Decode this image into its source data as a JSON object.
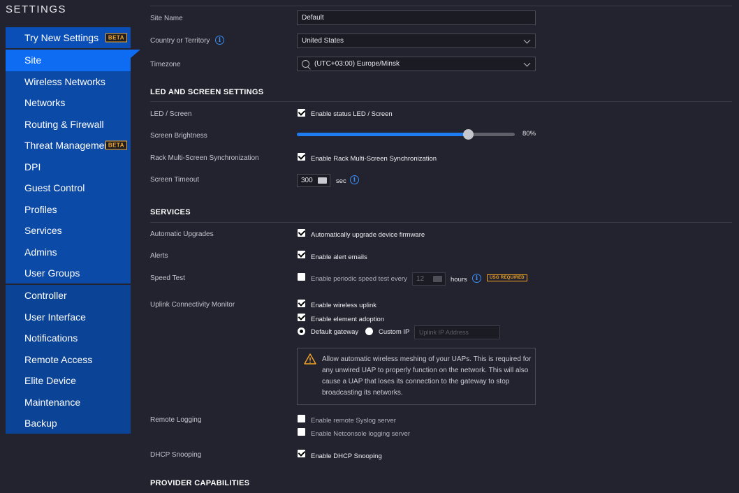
{
  "sidebar": {
    "title": "SETTINGS",
    "top_item": {
      "label": "Try New Settings",
      "badge": "BETA"
    },
    "items": [
      {
        "label": "Site"
      },
      {
        "label": "Wireless Networks"
      },
      {
        "label": "Networks"
      },
      {
        "label": "Routing & Firewall"
      },
      {
        "label": "Threat Management",
        "badge": "BETA"
      },
      {
        "label": "DPI"
      },
      {
        "label": "Guest Control"
      },
      {
        "label": "Profiles"
      },
      {
        "label": "Services"
      },
      {
        "label": "Admins"
      },
      {
        "label": "User Groups"
      }
    ],
    "items2": [
      {
        "label": "Controller"
      },
      {
        "label": "User Interface"
      },
      {
        "label": "Notifications"
      },
      {
        "label": "Remote Access"
      },
      {
        "label": "Elite Device"
      },
      {
        "label": "Maintenance"
      },
      {
        "label": "Backup"
      }
    ]
  },
  "site": {
    "site_name_label": "Site Name",
    "site_name_value": "Default",
    "country_label": "Country or Territory",
    "country_value": "United States",
    "timezone_label": "Timezone",
    "timezone_value": "(UTC+03:00) Europe/Minsk"
  },
  "led": {
    "section_title": "LED AND SCREEN SETTINGS",
    "led_label": "LED / Screen",
    "led_option": "Enable status LED / Screen",
    "brightness_label": "Screen Brightness",
    "brightness_value": "80%",
    "brightness_fraction": 0.785,
    "rack_label": "Rack Multi-Screen Synchronization",
    "rack_option": "Enable Rack Multi-Screen Synchronization",
    "timeout_label": "Screen Timeout",
    "timeout_value": "300",
    "timeout_unit": "sec"
  },
  "services": {
    "section_title": "SERVICES",
    "auto_upgrades_label": "Automatic Upgrades",
    "auto_upgrades_option": "Automatically upgrade device firmware",
    "alerts_label": "Alerts",
    "alerts_option": "Enable alert emails",
    "speed_label": "Speed Test",
    "speed_option": "Enable periodic speed test every",
    "speed_value": "12",
    "speed_unit": "hours",
    "speed_badge": "USG REQUIRED",
    "uplink_label": "Uplink Connectivity Monitor",
    "uplink_wireless": "Enable wireless uplink",
    "uplink_adoption": "Enable element adoption",
    "radio_default": "Default gateway",
    "radio_custom": "Custom IP",
    "uplink_ip_placeholder": "Uplink IP Address",
    "warning_text": "Allow automatic wireless meshing of your UAPs. This is required for any unwired UAP to properly function on the network. This will also cause a UAP that loses its connection to the gateway to stop broadcasting its networks.",
    "remote_logging_label": "Remote Logging",
    "syslog_option": "Enable remote Syslog server",
    "netconsole_option": "Enable Netconsole logging server",
    "dhcp_label": "DHCP Snooping",
    "dhcp_option": "Enable DHCP Snooping"
  },
  "provider": {
    "section_title": "PROVIDER CAPABILITIES"
  },
  "colors": {
    "accent": "#0d6cf2",
    "sidebar": "#0c4aa8",
    "background": "#22232e",
    "badge": "#f5a623"
  }
}
